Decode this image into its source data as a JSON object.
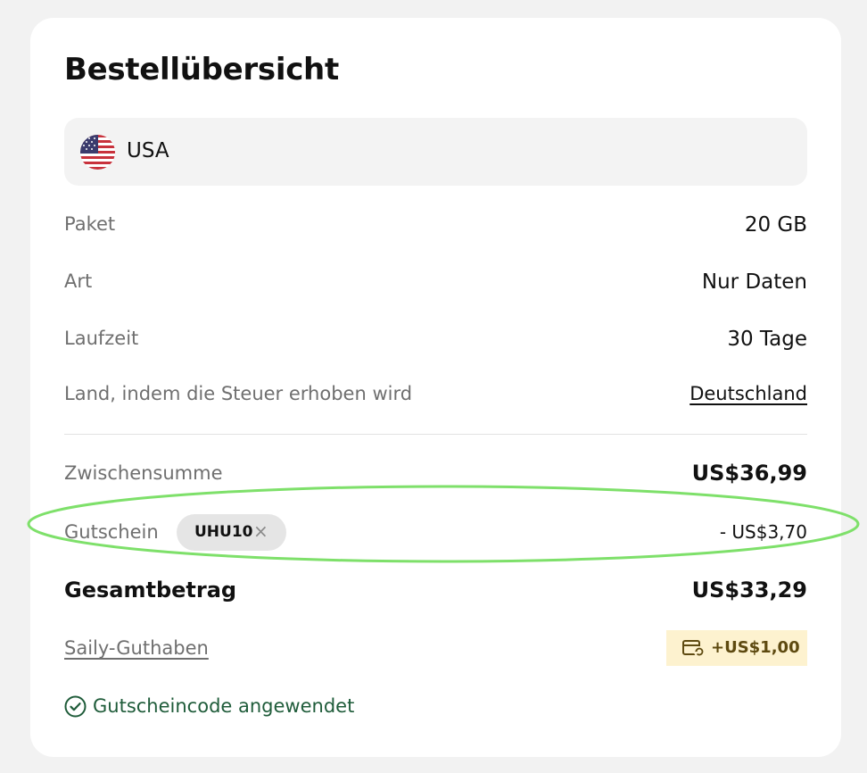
{
  "order_summary": {
    "title": "Bestellübersicht",
    "country": {
      "name": "USA",
      "flag_icon": "us-flag-icon"
    },
    "rows": [
      {
        "label": "Paket",
        "value": "20 GB"
      },
      {
        "label": "Art",
        "value": "Nur Daten"
      },
      {
        "label": "Laufzeit",
        "value": "30 Tage"
      }
    ],
    "tax_country": {
      "label": "Land, indem die Steuer erhoben wird",
      "value": "Deutschland"
    },
    "subtotal": {
      "label": "Zwischensumme",
      "value": "US$36,99"
    },
    "coupon": {
      "label": "Gutschein",
      "code": "UHU10",
      "remove_symbol": "×",
      "discount": "- US$3,70"
    },
    "total": {
      "label": "Gesamtbetrag",
      "value": "US$33,29"
    },
    "credit": {
      "label": "Saily-Guthaben",
      "amount": "+US$1,00",
      "icon": "wallet-refresh-icon"
    },
    "status": {
      "text": "Gutscheincode angewendet",
      "icon": "check-circle-icon"
    }
  },
  "colors": {
    "page_bg": "#f2f2f2",
    "card_bg": "#ffffff",
    "muted_text": "#6f6f6f",
    "success_green": "#1f5c3a",
    "credit_badge_bg": "#fdf2cf",
    "highlight_ring": "#7ee06a"
  }
}
